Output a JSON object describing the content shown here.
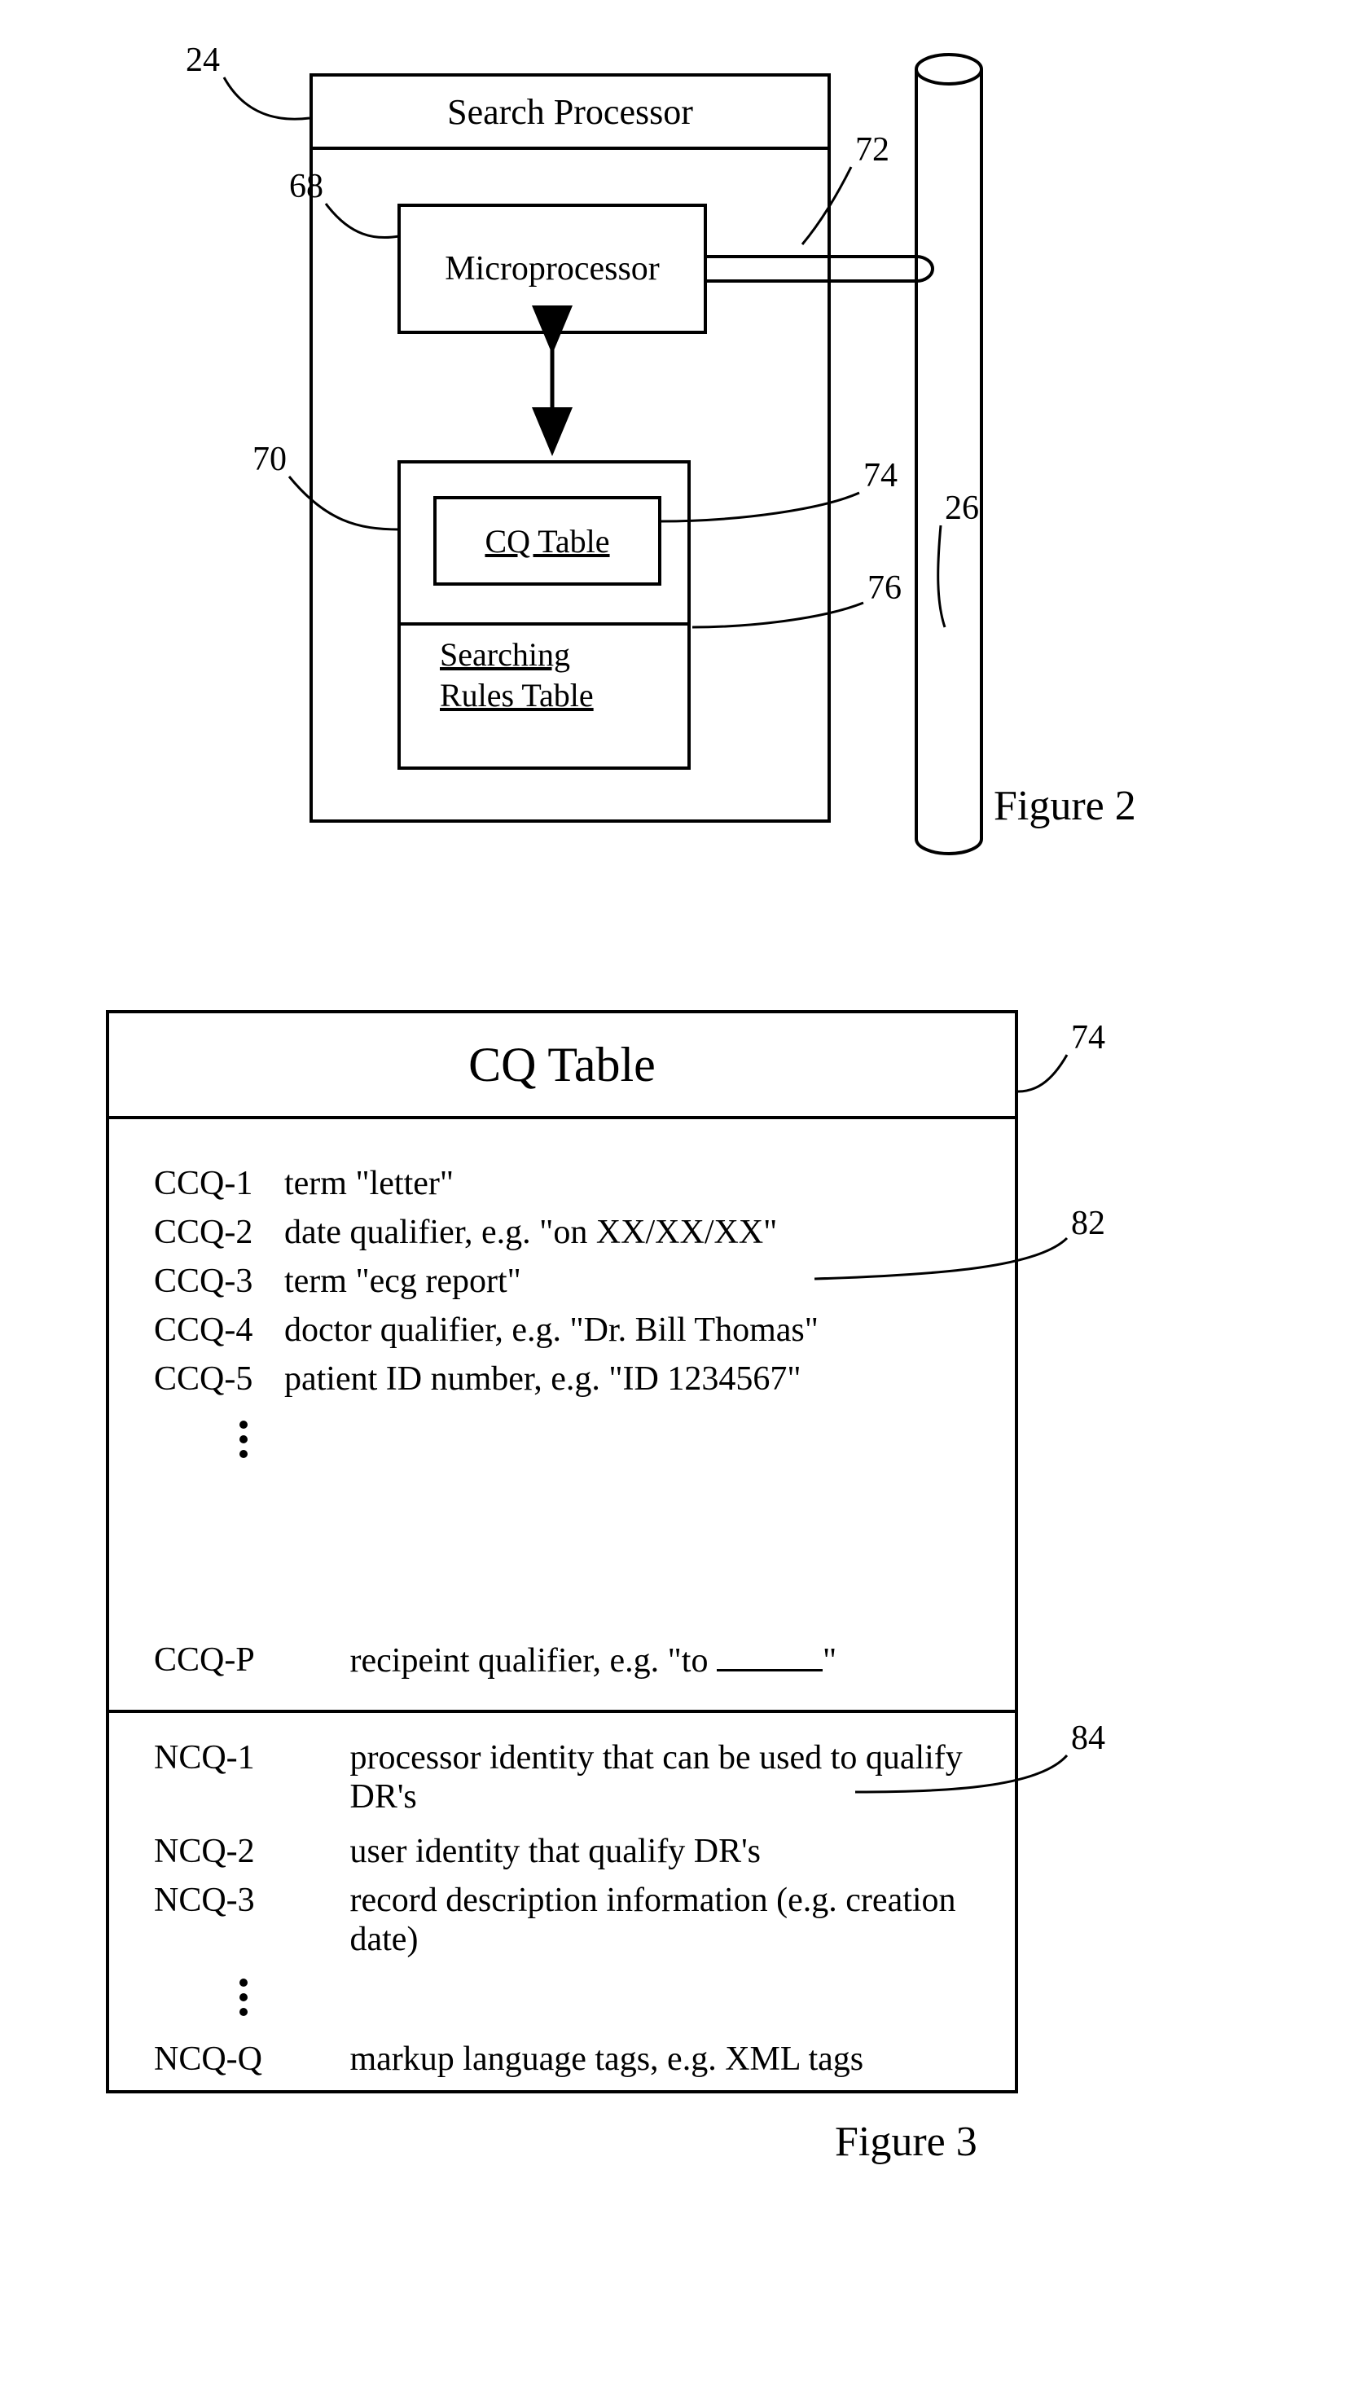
{
  "figure2": {
    "title": "Search Processor",
    "micro": "Microprocessor",
    "cq": "CQ Table",
    "sr_line1": "Searching",
    "sr_line2": "Rules Table",
    "caption": "Figure 2",
    "refs": {
      "r24": "24",
      "r68": "68",
      "r70": "70",
      "r72": "72",
      "r74": "74",
      "r76": "76",
      "r26": "26"
    }
  },
  "figure3": {
    "title": "CQ Table",
    "ccq": [
      {
        "key": "CCQ-1",
        "text": "term \"letter\""
      },
      {
        "key": "CCQ-2",
        "text": "date qualifier, e.g. \"on XX/XX/XX\""
      },
      {
        "key": "CCQ-3",
        "text": "term \"ecg report\""
      },
      {
        "key": "CCQ-4",
        "text": "doctor qualifier, e.g. \"Dr. Bill Thomas\""
      },
      {
        "key": "CCQ-5",
        "text": "patient ID number, e.g. \"ID 1234567\""
      }
    ],
    "ccqP": {
      "key": "CCQ-P",
      "prefix": "recipeint qualifier, e.g. \"to ",
      "suffix": "\""
    },
    "ncq": [
      {
        "key": "NCQ-1",
        "text": "processor identity that can be used to qualify DR's"
      },
      {
        "key": "NCQ-2",
        "text": "user identity that qualify DR's"
      },
      {
        "key": "NCQ-3",
        "text": "record description information (e.g. creation date)"
      }
    ],
    "ncqQ": {
      "key": "NCQ-Q",
      "text": "markup language tags, e.g. XML tags"
    },
    "caption": "Figure 3",
    "refs": {
      "r74": "74",
      "r82": "82",
      "r84": "84"
    }
  }
}
